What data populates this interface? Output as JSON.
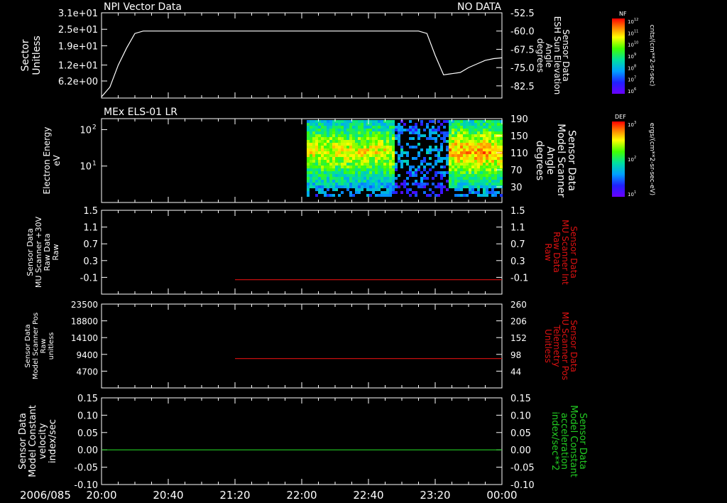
{
  "chart_data": [
    {
      "type": "line",
      "title": "NPI Vector Data",
      "status": "NO DATA",
      "ylabel_left": [
        "Sector",
        "Unitless"
      ],
      "ylabel_right": [
        "Sensor Data",
        "ESH Sun Elevation",
        "Angle",
        "degrees"
      ],
      "ylim_left": [
        0,
        31
      ],
      "ylim_right": [
        -87.5,
        -52.5
      ],
      "yticks_left": [
        {
          "value": 31,
          "label": "3.1e+01"
        },
        {
          "value": 25,
          "label": "2.5e+01"
        },
        {
          "value": 19,
          "label": "1.9e+01"
        },
        {
          "value": 12,
          "label": "1.2e+01"
        },
        {
          "value": 6.2,
          "label": "6.2e+00"
        }
      ],
      "yticks_right": [
        {
          "value": -52.5,
          "label": "-52.5"
        },
        {
          "value": -60,
          "label": "-60.0"
        },
        {
          "value": -67.5,
          "label": "-67.5"
        },
        {
          "value": -75,
          "label": "-75.0"
        },
        {
          "value": -82.5,
          "label": "-82.5"
        }
      ],
      "series": [
        {
          "color": "#ffffff",
          "x": [
            0,
            5,
            10,
            15,
            20,
            25,
            30,
            40,
            60,
            80,
            100,
            110,
            118,
            120,
            125,
            130,
            135,
            140,
            150,
            160,
            170,
            180,
            190,
            195,
            200,
            205,
            210,
            215,
            220,
            225,
            230,
            235,
            240
          ],
          "y": [
            -87,
            -83,
            -74,
            -67,
            -61,
            -60,
            -60,
            -60,
            -60,
            -60,
            -60,
            -60,
            -60,
            -60,
            -60,
            -60,
            -60,
            -60,
            -60,
            -60,
            -60,
            -60,
            -60,
            -61,
            -70,
            -78,
            -77.5,
            -77,
            -75,
            -73.5,
            -72,
            -71.3,
            -71
          ]
        }
      ]
    },
    {
      "type": "heatmap",
      "title": "MEx ELS-01 LR",
      "ylabel_left": [
        "Electron Energy",
        "eV"
      ],
      "ylabel_right": [
        "Sensor Data",
        "Model Scanner",
        "Angle",
        "degrees"
      ],
      "yticks_left": [
        {
          "value": 100,
          "label": "10",
          "exp": "2"
        },
        {
          "value": 10,
          "label": "10",
          "exp": "1"
        }
      ],
      "yticks_right": [
        "190",
        "150",
        "110",
        "70",
        "30"
      ],
      "colorbar": {
        "label": "DEF",
        "unit": "ergs/(cm**2-sr-sec-eV)",
        "ticks": [
          {
            "label": "10",
            "exp": "3"
          },
          {
            "label": "10",
            "exp": "2"
          },
          {
            "label": "10",
            "exp": "1"
          }
        ]
      },
      "data_start_minutes": 123
    },
    {
      "type": "line",
      "ylabel_left": [
        "Sensor Data",
        "MU Scanner +30V",
        "Raw Data",
        "Raw"
      ],
      "ylabel_right": [
        "Sensor Data",
        "MU Scanner Int",
        "Raw Data",
        "Raw"
      ],
      "ylim": [
        -0.3,
        1.5
      ],
      "yticks_left": [
        "1.5",
        "1.1",
        "0.7",
        "0.3",
        "-0.1"
      ],
      "yticks_right": [
        "1.5",
        "1.1",
        "0.7",
        "0.3",
        "-0.1"
      ],
      "series": [
        {
          "color": "#dd1111",
          "x": [
            80,
            240
          ],
          "y": [
            0.01,
            0.01
          ]
        }
      ]
    },
    {
      "type": "line",
      "ylabel_left": [
        "Sensor Data",
        "Model Scanner Pos",
        "Raw",
        "unitless"
      ],
      "ylabel_right": [
        "Sensor Data",
        "MU Scanner Pos",
        "Telemetry",
        "Unitless"
      ],
      "yticks_left": [
        "23500",
        "18800",
        "14100",
        "9400",
        "4700"
      ],
      "yticks_right": [
        "260",
        "206",
        "152",
        "98",
        "44"
      ],
      "ylim_right": [
        0,
        260
      ],
      "series": [
        {
          "color": "#dd1111",
          "x": [
            80,
            240
          ],
          "y": [
            91,
            91
          ]
        }
      ]
    },
    {
      "type": "line",
      "ylabel_left": [
        "Sensor Data",
        "Model Constant",
        "velocity",
        "index/sec"
      ],
      "ylabel_right": [
        "Sensor Data",
        "Model Constant",
        "acceleration",
        "index/sec**2"
      ],
      "ylim": [
        -0.1,
        0.15
      ],
      "yticks_left": [
        "0.15",
        "0.10",
        "0.05",
        "0.00",
        "-0.05",
        "-0.10"
      ],
      "yticks_right": [
        "0.15",
        "0.10",
        "0.05",
        "0.00",
        "-0.05",
        "-0.10"
      ],
      "series": [
        {
          "color": "#22cc22",
          "x": [
            0,
            240
          ],
          "y": [
            0,
            0
          ]
        }
      ]
    }
  ],
  "colorbar_top": {
    "label": "NF",
    "unit": "cnts/(cm**2-sr-sec)",
    "ticks": [
      {
        "label": "10",
        "exp": "12"
      },
      {
        "label": "10",
        "exp": "11"
      },
      {
        "label": "10",
        "exp": "10"
      },
      {
        "label": "10",
        "exp": "9"
      },
      {
        "label": "10",
        "exp": "8"
      },
      {
        "label": "10",
        "exp": "7"
      },
      {
        "label": "10",
        "exp": "6"
      }
    ]
  },
  "x_axis": {
    "date": "2006/085",
    "ticks": [
      "20:00",
      "20:40",
      "21:20",
      "22:00",
      "22:40",
      "23:20",
      "00:00"
    ],
    "range_minutes": [
      0,
      240
    ]
  }
}
